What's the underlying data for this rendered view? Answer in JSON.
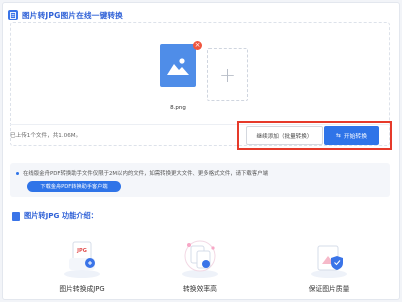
{
  "header": {
    "title": "图片转JPG图片在线一键转换"
  },
  "upload": {
    "file_name": "8.png",
    "close_glyph": "×",
    "add_glyph": "+",
    "summary": "已上传1个文件，共1.06M。",
    "continue_label": "继续添加（批量转换）",
    "start_label": "开始转换",
    "start_icon_glyph": "⇆"
  },
  "notice": {
    "text": "在线版金舟PDF转换助手文件仅限于2M以内的文件，如需转换更大文件、更多格式文件，请下载客户端",
    "download_label": "下载金舟PDF转换助手客户端"
  },
  "features": {
    "title": "图片转JPG 功能介绍：",
    "items": [
      {
        "label": "图片转换成JPG",
        "icon": "jpg-convert-icon",
        "badge": "JPG"
      },
      {
        "label": "转换效率高",
        "icon": "efficiency-icon"
      },
      {
        "label": "保证图片质量",
        "icon": "quality-shield-icon"
      }
    ]
  },
  "colors": {
    "accent": "#2f74e8",
    "highlight": "#e63a2a",
    "title_blue": "#2f61d7"
  }
}
